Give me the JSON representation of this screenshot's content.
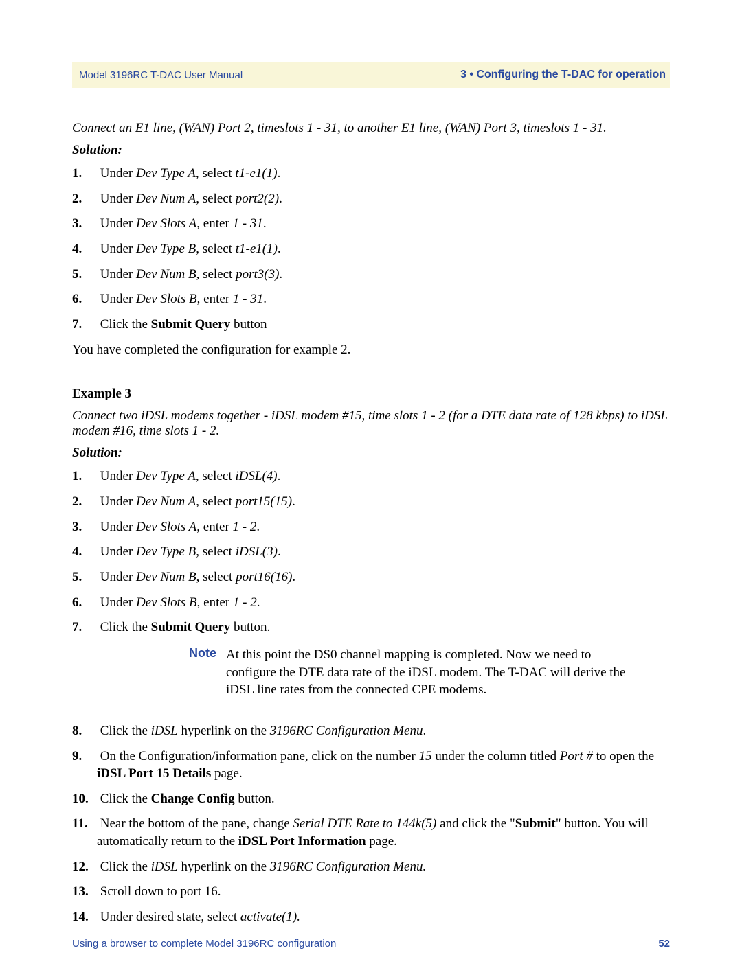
{
  "header": {
    "left": "Model 3196RC T-DAC User Manual",
    "right": "3 • Configuring the T-DAC for operation"
  },
  "example2": {
    "intro": "Connect an E1 line, (WAN) Port 2, timeslots 1 - 31, to another E1 line, (WAN) Port 3, timeslots 1 - 31.",
    "solution_label": "Solution:",
    "steps": {
      "s1": {
        "pre": "Under ",
        "em1": "Dev Type A",
        "mid": ", select ",
        "em2": "t1-e1(1)",
        "post": "."
      },
      "s2": {
        "pre": "Under ",
        "em1": "Dev Num A",
        "mid": ", select ",
        "em2": "port2(2)",
        "post": "."
      },
      "s3": {
        "pre": "Under ",
        "em1": "Dev Slots A",
        "mid": ", enter ",
        "em2": "1 - 31",
        "post": "."
      },
      "s4": {
        "pre": "Under ",
        "em1": "Dev Type B",
        "mid": ", select ",
        "em2": "t1-e1(1)",
        "post": "."
      },
      "s5": {
        "pre": "Under ",
        "em1": "Dev Num B",
        "mid": ", select ",
        "em2": "port3(3)",
        "post": "."
      },
      "s6": {
        "pre": "Under ",
        "em1": "Dev Slots B",
        "mid": ", enter ",
        "em2": "1 - 31",
        "post": "."
      },
      "s7": {
        "pre": "Click the ",
        "b1": "Submit Query",
        "post": " button"
      }
    },
    "completed": "You have completed the configuration for example 2."
  },
  "example3": {
    "title": "Example 3",
    "intro": "Connect two iDSL modems together - iDSL modem #15, time slots 1 - 2 (for a DTE data rate of 128 kbps) to iDSL modem #16, time slots 1 - 2.",
    "solution_label": "Solution:",
    "steps": {
      "s1": {
        "pre": "Under ",
        "em1": "Dev Type A",
        "mid": ", select ",
        "em2": "iDSL(4)",
        "post": "."
      },
      "s2": {
        "pre": "Under ",
        "em1": "Dev Num A",
        "mid": ", select ",
        "em2": "port15(15)",
        "post": "."
      },
      "s3": {
        "pre": "Under ",
        "em1": "Dev Slots A",
        "mid": ", enter ",
        "em2": "1 - 2",
        "post": "."
      },
      "s4": {
        "pre": "Under ",
        "em1": "Dev Type B",
        "mid": ", select ",
        "em2": "iDSL(3)",
        "post": "."
      },
      "s5": {
        "pre": "Under ",
        "em1": "Dev Num B",
        "mid": ", select ",
        "em2": "port16(16)",
        "post": "."
      },
      "s6": {
        "pre": "Under ",
        "em1": "Dev Slots B",
        "mid": ", enter ",
        "em2": "1 - 2",
        "post": "."
      },
      "s7": {
        "pre": "Click the ",
        "b1": "Submit Query",
        "post": " button."
      },
      "s8": {
        "pre": "Click the ",
        "em1": "iDSL",
        "mid": " hyperlink on the ",
        "em2": "3196RC Configuration Menu",
        "post": "."
      },
      "s9": {
        "pre": "On the Configuration/information pane, click on the number ",
        "em1": "15",
        "mid": " under the column titled ",
        "em2": "Port #",
        "mid2": " to open the ",
        "b1": "iDSL Port 15 Details",
        "post": " page."
      },
      "s10": {
        "pre": "Click the ",
        "b1": "Change Config",
        "post": " button."
      },
      "s11": {
        "pre": "Near the bottom of the pane, change ",
        "em1": "Serial DTE Rate to 144k(5)",
        "mid": " and click the \"",
        "b1": "Submit",
        "mid2": "\" button. You will automatically return to the ",
        "b2": "iDSL Port Information",
        "post": " page."
      },
      "s12": {
        "pre": "Click the ",
        "em1": "iDSL",
        "mid": " hyperlink on the ",
        "em2": "3196RC Configuration Menu.",
        "post": ""
      },
      "s13": {
        "pre": "Scroll down to port 16.",
        "post": ""
      },
      "s14": {
        "pre": "Under desired state, select ",
        "em1": "activate(1).",
        "post": ""
      }
    },
    "note": {
      "label": "Note",
      "text": "At this point the DS0 channel mapping is completed. Now we need to configure the DTE data rate of the iDSL modem. The T-DAC will derive the iDSL line rates from the connected CPE modems."
    }
  },
  "footer": {
    "left": "Using a browser to complete Model 3196RC configuration",
    "page": "52"
  }
}
